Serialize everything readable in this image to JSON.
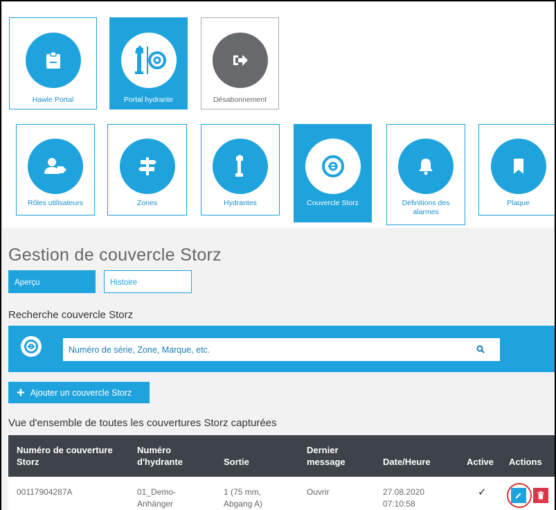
{
  "apps": [
    {
      "label": "Hawle Portal",
      "icon": "clipboard-icon",
      "selected": false
    },
    {
      "label": "Portal hydrante",
      "icon": "hydrant-storz-icon",
      "selected": true
    },
    {
      "label": "Désabonnement",
      "icon": "logout-icon",
      "selected": false
    }
  ],
  "modules": [
    {
      "label": "Rôles utilisateurs",
      "icon": "user-tag-icon"
    },
    {
      "label": "Zones",
      "icon": "signpost-icon"
    },
    {
      "label": "Hydrantes",
      "icon": "hydrant-icon"
    },
    {
      "label": "Couvercle Storz",
      "icon": "storz-icon",
      "selected": true
    },
    {
      "label": "Définitions des alarmes",
      "icon": "bell-icon"
    },
    {
      "label": "Plaque",
      "icon": "bookmark-icon"
    }
  ],
  "page": {
    "title": "Gestion de couvercle Storz",
    "tabs": {
      "overview": "Aperçu",
      "history": "Histoire"
    },
    "search_section": "Recherche couvercle Storz",
    "search_placeholder": "Numéro de série, Zone, Marque, etc.",
    "add_button": "Ajouter un couvercle Storz",
    "overview_section": "Vue d'ensemble de toutes les couvertures Storz capturées"
  },
  "table": {
    "headers": {
      "cover_number_l1": "Numéro de couverture",
      "cover_number_l2": "Storz",
      "hydrant_number_l1": "Numéro",
      "hydrant_number_l2": "d'hydrante",
      "outlet": "Sortie",
      "last_message_l1": "Dernier",
      "last_message_l2": "message",
      "datetime": "Date/Heure",
      "active": "Active",
      "actions": "Actions"
    },
    "rows": [
      {
        "cover_number": "00117904287A",
        "hydrant_l1": "01_Demo-",
        "hydrant_l2": "Anhänger",
        "outlet_l1": "1 (75 mm,",
        "outlet_l2": "Abgang A)",
        "last_message": "Ouvrir",
        "date": "27.08.2020",
        "time": "07:10:58",
        "active": "✓"
      }
    ]
  },
  "colors": {
    "accent": "#1fa3dd",
    "header_dark": "#3d4348",
    "delete": "#dc3545",
    "highlight_ring": "#d9322e"
  }
}
